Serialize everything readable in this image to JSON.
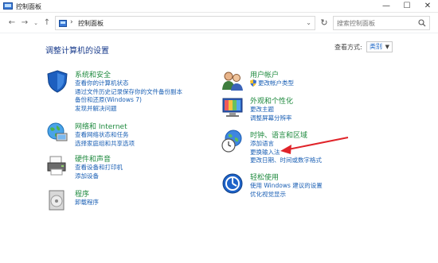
{
  "window": {
    "title": "控制面板",
    "minimize": "—",
    "maximize": "☐",
    "close": "✕"
  },
  "address": {
    "crumb": "控制面板",
    "separator": "›"
  },
  "search": {
    "placeholder": "搜索控制面板"
  },
  "main": {
    "heading": "调整计算机的设置",
    "view_by_label": "查看方式:",
    "view_by_value": "类别"
  },
  "categories": [
    {
      "title": "系统和安全",
      "links": [
        "查看你的计算机状态",
        "通过文件历史记录保存你的文件备份副本",
        "备份和还原(Windows 7)",
        "发现并解决问题"
      ]
    },
    {
      "title": "网络和 Internet",
      "links": [
        "查看网络状态和任务",
        "选择家庭组和共享选项"
      ]
    },
    {
      "title": "硬件和声音",
      "links": [
        "查看设备和打印机",
        "添加设备"
      ]
    },
    {
      "title": "程序",
      "links": [
        "卸载程序"
      ]
    },
    {
      "title": "用户帐户",
      "links": [
        "更改帐户类型"
      ]
    },
    {
      "title": "外观和个性化",
      "links": [
        "更改主题",
        "调整屏幕分辨率"
      ]
    },
    {
      "title": "时钟、语言和区域",
      "links": [
        "添加语言",
        "更换输入法",
        "更改日期、时间或数字格式"
      ]
    },
    {
      "title": "轻松使用",
      "links": [
        "使用 Windows 建议的设置",
        "优化视觉显示"
      ]
    }
  ],
  "annotation": {
    "arrow_color": "#e0242a"
  },
  "colors": {
    "category_title": "#1f8a3f",
    "link": "#1a5fb4",
    "heading": "#1a3c8c"
  }
}
